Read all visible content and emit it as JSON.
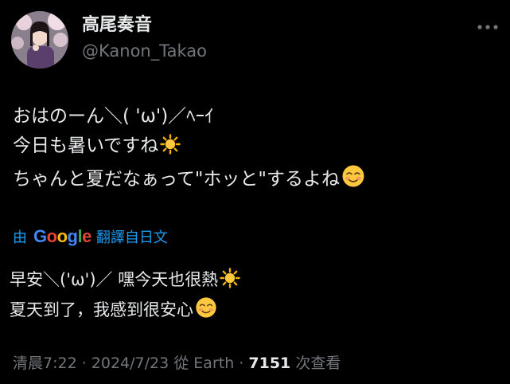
{
  "author": {
    "display_name": "高尾奏音",
    "handle": "@Kanon_Takao"
  },
  "header": {
    "more_icon": "more-horizontal-icon"
  },
  "tweet": {
    "lines": [
      "おはのーん＼( 'ω')／ﾍｰｲ",
      "今日も暑いですね",
      "ちゃんと夏だなぁって\"ホッと\"するよね"
    ],
    "emojis": [
      "sun-emoji-icon",
      "smiling-face-emoji-icon"
    ]
  },
  "translation": {
    "by_label": "由",
    "provider": [
      "G",
      "o",
      "o",
      "g",
      "l",
      "e"
    ],
    "provider_colors": [
      "#4285f4",
      "#ea4335",
      "#fbbc05",
      "#4285f4",
      "#34a853",
      "#ea4335"
    ],
    "action_label": "翻譯自日文",
    "lines": [
      "早安＼('ω')／  嘿今天也很熱",
      "夏天到了，我感到很安心"
    ]
  },
  "meta": {
    "time": "清晨7:22",
    "separator": " · ",
    "date": "2024/7/23",
    "source": "從 Earth",
    "views_count": "7151",
    "views_label": " 次查看"
  },
  "colors": {
    "background": "#000000",
    "text": "#e7e9ea",
    "secondary": "#71767b",
    "link": "#1d9bf0"
  }
}
